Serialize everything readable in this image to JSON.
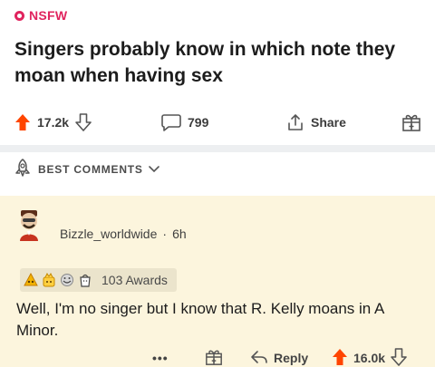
{
  "post": {
    "nsfw_label": "NSFW",
    "title": "Singers probably know in which note they moan when having sex",
    "upvotes": "17.2k",
    "comments": "799",
    "share_label": "Share"
  },
  "comments_section": {
    "sort_label": "BEST COMMENTS"
  },
  "comment": {
    "author": "Bizzle_worldwide",
    "separator": "·",
    "age": "6h",
    "awards_count": "103 Awards",
    "body": "Well, I'm no singer but I know that R. Kelly moans in A Minor.",
    "more_label": "•••",
    "reply_label": "Reply",
    "upvotes": "16.0k"
  },
  "colors": {
    "nsfw": "#e0245e",
    "upvote": "#ff4500",
    "comment_bg": "#fcf5dd",
    "divider": "#edeff1"
  },
  "icons": [
    "nsfw-icon",
    "upvote-arrow-icon",
    "downvote-arrow-icon",
    "comment-bubble-icon",
    "share-icon",
    "award-icon",
    "rocket-icon",
    "chevron-down-icon",
    "avatar-icon",
    "gift-icon",
    "reply-icon"
  ]
}
